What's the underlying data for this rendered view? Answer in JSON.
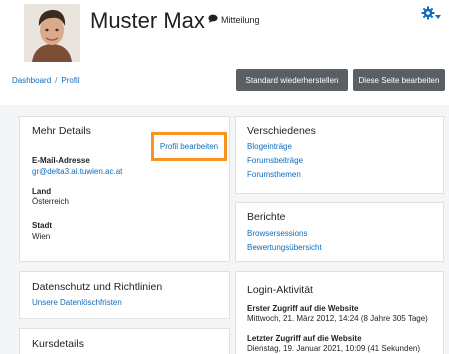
{
  "header": {
    "user_name": "Muster Max",
    "message_label": "Mitteilung"
  },
  "breadcrumb": {
    "items": [
      "Dashboard",
      "Profil"
    ]
  },
  "toolbar": {
    "reset_label": "Standard wiederherstellen",
    "edit_page_label": "Diese Seite bearbeiten"
  },
  "more_details": {
    "title": "Mehr Details",
    "edit_profile_label": "Profil bearbeiten",
    "email_label": "E-Mail-Adresse",
    "email_value": "gr@delta3.ai.tuwien.ac.at",
    "country_label": "Land",
    "country_value": "Österreich",
    "city_label": "Stadt",
    "city_value": "Wien"
  },
  "privacy": {
    "title": "Datenschutz und Richtlinien",
    "link": "Unsere Datenlöschfristen"
  },
  "course_details": {
    "title": "Kursdetails"
  },
  "misc": {
    "title": "Verschiedenes",
    "links": [
      "Blogeinträge",
      "Forumsbeiträge",
      "Forumsthemen"
    ]
  },
  "reports": {
    "title": "Berichte",
    "links": [
      "Browsersessions",
      "Bewertungsübersicht"
    ]
  },
  "login_activity": {
    "title": "Login-Aktivität",
    "first_access_label": "Erster Zugriff auf die Website",
    "first_access_value": "Mittwoch, 21. März 2012, 14:24  (8 Jahre 305 Tage)",
    "last_access_label": "Letzter Zugriff auf die Website",
    "last_access_value": "Dienstag, 19. Januar 2021, 10:09  (41 Sekunden)"
  },
  "colors": {
    "link": "#0f6cbf",
    "button": "#5a5f64",
    "highlight": "#f7931e"
  }
}
